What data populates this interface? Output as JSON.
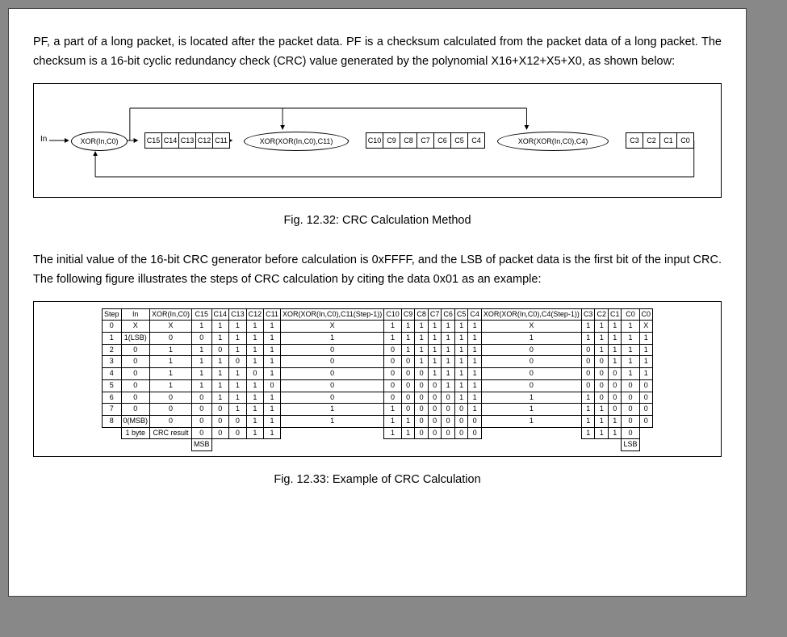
{
  "text": {
    "para1": "PF, a part of a long packet, is located after the packet data. PF is a checksum calculated from the packet data of a long packet. The checksum is a 16-bit cyclic redundancy check (CRC) value generated by the polynomial X16+X12+X5+X0, as shown below:",
    "para2": "The initial value of the 16-bit CRC generator before calculation is 0xFFFF, and the LSB of packet data is the first bit of the input CRC. The following figure illustrates the steps of CRC calculation by citing the data 0x01 as an example:",
    "caption1": "Fig. 12.32: CRC Calculation Method",
    "caption2": "Fig. 12.33: Example of CRC Calculation",
    "inLabel": "In",
    "xor1": "XOR(In,C0)",
    "xor2": "XOR(XOR(In,C0),C11)",
    "xor3": "XOR(XOR(In,C0),C4)",
    "msb": "MSB",
    "lsb": "LSB"
  },
  "diagram": {
    "group1": [
      "C15",
      "C14",
      "C13",
      "C12",
      "C11"
    ],
    "group2": [
      "C10",
      "C9",
      "C8",
      "C7",
      "C6",
      "C5",
      "C4"
    ],
    "group3": [
      "C3",
      "C2",
      "C1",
      "C0"
    ]
  },
  "table": {
    "headers": [
      "Step",
      "In",
      "XOR(In,C0)",
      "C15",
      "C14",
      "C13",
      "C12",
      "C11",
      "XOR(XOR(In,C0),C11(Step-1))",
      "C10",
      "C9",
      "C8",
      "C7",
      "C6",
      "C5",
      "C4",
      "XOR(XOR(In,C0),C4(Step-1))",
      "C3",
      "C2",
      "C1",
      "C0",
      "C0"
    ],
    "rows": [
      [
        "0",
        "X",
        "X",
        "1",
        "1",
        "1",
        "1",
        "1",
        "X",
        "1",
        "1",
        "1",
        "1",
        "1",
        "1",
        "1",
        "X",
        "1",
        "1",
        "1",
        "1",
        "X"
      ],
      [
        "1",
        "1(LSB)",
        "0",
        "0",
        "1",
        "1",
        "1",
        "1",
        "1",
        "1",
        "1",
        "1",
        "1",
        "1",
        "1",
        "1",
        "1",
        "1",
        "1",
        "1",
        "1",
        "1"
      ],
      [
        "2",
        "0",
        "1",
        "1",
        "0",
        "1",
        "1",
        "1",
        "0",
        "0",
        "1",
        "1",
        "1",
        "1",
        "1",
        "1",
        "0",
        "0",
        "1",
        "1",
        "1",
        "1"
      ],
      [
        "3",
        "0",
        "1",
        "1",
        "1",
        "0",
        "1",
        "1",
        "0",
        "0",
        "0",
        "1",
        "1",
        "1",
        "1",
        "1",
        "0",
        "0",
        "0",
        "1",
        "1",
        "1"
      ],
      [
        "4",
        "0",
        "1",
        "1",
        "1",
        "1",
        "0",
        "1",
        "0",
        "0",
        "0",
        "0",
        "1",
        "1",
        "1",
        "1",
        "0",
        "0",
        "0",
        "0",
        "1",
        "1"
      ],
      [
        "5",
        "0",
        "1",
        "1",
        "1",
        "1",
        "1",
        "0",
        "0",
        "0",
        "0",
        "0",
        "0",
        "1",
        "1",
        "1",
        "0",
        "0",
        "0",
        "0",
        "0",
        "0"
      ],
      [
        "6",
        "0",
        "0",
        "0",
        "1",
        "1",
        "1",
        "1",
        "0",
        "0",
        "0",
        "0",
        "0",
        "0",
        "1",
        "1",
        "1",
        "1",
        "0",
        "0",
        "0",
        "0"
      ],
      [
        "7",
        "0",
        "0",
        "0",
        "0",
        "1",
        "1",
        "1",
        "1",
        "1",
        "0",
        "0",
        "0",
        "0",
        "0",
        "1",
        "1",
        "1",
        "1",
        "0",
        "0",
        "0"
      ],
      [
        "8",
        "0(MSB)",
        "0",
        "0",
        "0",
        "0",
        "1",
        "1",
        "1",
        "1",
        "1",
        "0",
        "0",
        "0",
        "0",
        "0",
        "1",
        "1",
        "1",
        "1",
        "0",
        "0"
      ]
    ],
    "footer": [
      "",
      "1 byte",
      "CRC result",
      "0",
      "0",
      "0",
      "1",
      "1",
      "",
      "1",
      "1",
      "0",
      "0",
      "0",
      "0",
      "0",
      "",
      "1",
      "1",
      "1",
      "0",
      ""
    ]
  }
}
